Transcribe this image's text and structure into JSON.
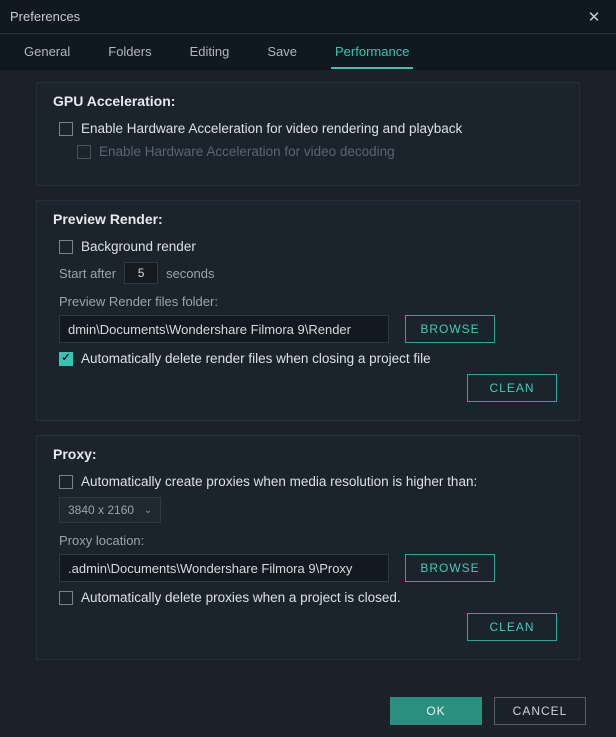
{
  "title": "Preferences",
  "tabs": {
    "general": "General",
    "folders": "Folders",
    "editing": "Editing",
    "save": "Save",
    "performance": "Performance"
  },
  "gpu": {
    "title": "GPU Acceleration:",
    "opt1": "Enable Hardware Acceleration for video rendering and playback",
    "opt2": "Enable Hardware Acceleration for video decoding"
  },
  "preview": {
    "title": "Preview Render:",
    "background": "Background render",
    "start_prefix": "Start after",
    "start_value": "5",
    "start_suffix": "seconds",
    "folder_label": "Preview Render files folder:",
    "folder_value": "dmin\\Documents\\Wondershare Filmora 9\\Render",
    "browse": "BROWSE",
    "autodelete": "Automatically delete render files when closing a project file",
    "clean": "CLEAN"
  },
  "proxy": {
    "title": "Proxy:",
    "autocreate": "Automatically create proxies when media resolution is higher than:",
    "resolution": "3840 x 2160",
    "location_label": "Proxy location:",
    "location_value": ".admin\\Documents\\Wondershare Filmora 9\\Proxy",
    "browse": "BROWSE",
    "autodelete": "Automatically delete proxies when a project is closed.",
    "clean": "CLEAN"
  },
  "footer": {
    "ok": "OK",
    "cancel": "CANCEL"
  }
}
